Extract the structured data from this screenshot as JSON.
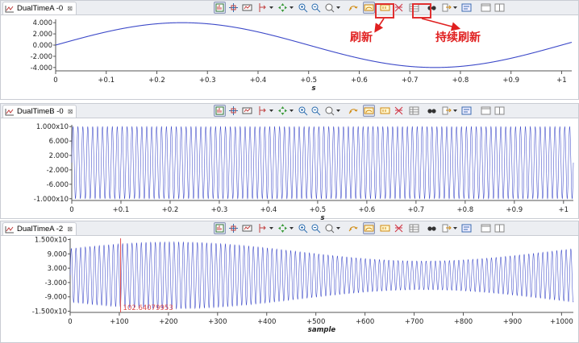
{
  "plots": [
    {
      "tab": {
        "label": "DualTimeA -0",
        "close": "⊠",
        "icon": "chart-line-icon"
      },
      "active_buttons": [
        "refresh",
        "continuous-refresh"
      ],
      "chart_data": {
        "type": "line",
        "ytick_labels": [
          "4.000",
          "2.000",
          "0.000",
          "-2.000",
          "-4.000"
        ],
        "ytick_values": [
          4,
          2,
          0,
          -2,
          -4
        ],
        "ylim": [
          -4.6,
          4.6
        ],
        "xtick_labels": [
          "0",
          "+0.1",
          "+0.2",
          "+0.3",
          "+0.4",
          "+0.5",
          "+0.6",
          "+0.7",
          "+0.8",
          "+0.9",
          "+1"
        ],
        "xtick_values": [
          0,
          0.1,
          0.2,
          0.3,
          0.4,
          0.5,
          0.6,
          0.7,
          0.8,
          0.9,
          1.0
        ],
        "xlim": [
          0,
          1.02
        ],
        "xlabel": "s",
        "series": [
          {
            "kind": "sine",
            "amplitude": 4.0,
            "frequency": 1.0,
            "offset": 0
          }
        ],
        "color": "#3b48c8"
      }
    },
    {
      "tab": {
        "label": "DualTimeB -0",
        "close": "⊠",
        "icon": "chart-line-icon"
      },
      "active_buttons": [],
      "chart_data": {
        "type": "line",
        "ytick_labels": [
          "1.000x10",
          "6.000",
          "2.000",
          "-2.000",
          "-6.000",
          "-1.000x10"
        ],
        "ytick_values": [
          10,
          6,
          2,
          -2,
          -6,
          -10
        ],
        "ylim": [
          -10.5,
          10.5
        ],
        "xtick_labels": [
          "0",
          "+0.1",
          "+0.2",
          "+0.3",
          "+0.4",
          "+0.5",
          "+0.6",
          "+0.7",
          "+0.8",
          "+0.9",
          "+1"
        ],
        "xtick_values": [
          0,
          0.1,
          0.2,
          0.3,
          0.4,
          0.5,
          0.6,
          0.7,
          0.8,
          0.9,
          1.0
        ],
        "xlim": [
          0,
          1.02
        ],
        "xlabel": "s",
        "series": [
          {
            "kind": "sine",
            "amplitude": 10.0,
            "frequency": 100,
            "offset": 0
          }
        ],
        "color": "#3b48c8"
      }
    },
    {
      "tab": {
        "label": "DualTimeA -2",
        "close": "⊠",
        "icon": "chart-line-icon"
      },
      "active_buttons": [],
      "chart_data": {
        "type": "line",
        "ytick_labels": [
          "1.500x10",
          "9.000",
          "3.000",
          "-3.000",
          "-9.000",
          "-1.500x10"
        ],
        "ytick_values": [
          15,
          9,
          3,
          -3,
          -9,
          -15
        ],
        "ylim": [
          -15.5,
          15.5
        ],
        "xtick_labels": [
          "0",
          "+100",
          "+200",
          "+300",
          "+400",
          "+500",
          "+600",
          "+700",
          "+800",
          "+900",
          "+1000"
        ],
        "xtick_values": [
          0,
          100,
          200,
          300,
          400,
          500,
          600,
          700,
          800,
          900,
          1000
        ],
        "xlim": [
          0,
          1024
        ],
        "xlabel": "sample",
        "series": [
          {
            "kind": "modulated-sine",
            "amplitude": 10.0,
            "period_samples": 9.5,
            "modulation_amplitude": 4.0,
            "modulation_period_samples": 1024
          }
        ],
        "color": "#3b48c8",
        "cursor": {
          "x": 102.64,
          "label": "102.64079953",
          "color": "#e05050"
        }
      }
    }
  ],
  "toolbar_icons": [
    "auto-scale-icon",
    "center-icon",
    "fit-icon",
    "cursor-icon",
    "move-icon",
    "zoom-in-icon",
    "zoom-out-icon",
    "zoom-box-icon",
    "refresh-icon",
    "continuous-refresh-icon",
    "hold-icon",
    "clear-icon",
    "table-icon",
    "find-icon",
    "export-icon",
    "properties-icon",
    "view-1-icon",
    "view-2-icon"
  ],
  "annotations": {
    "refresh": "刷新",
    "continuous_refresh": "持续刷新",
    "color": "#e02020"
  }
}
